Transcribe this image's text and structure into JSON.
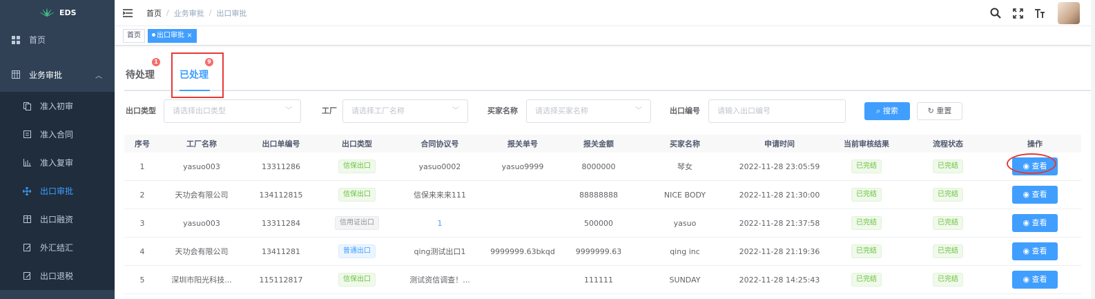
{
  "app": {
    "logo_text": "EDS"
  },
  "sidebar": {
    "items": [
      {
        "label": "首页",
        "icon": "dashboard-icon"
      },
      {
        "label": "业务审批",
        "icon": "table-icon",
        "expanded": true
      }
    ],
    "subitems": [
      {
        "label": "准入初审",
        "icon": "copy-icon"
      },
      {
        "label": "准入合同",
        "icon": "form-icon"
      },
      {
        "label": "准入复审",
        "icon": "chart-icon"
      },
      {
        "label": "出口审批",
        "icon": "move-icon",
        "active": true
      },
      {
        "label": "出口融资",
        "icon": "table2-icon"
      },
      {
        "label": "外汇结汇",
        "icon": "edit-icon"
      },
      {
        "label": "出口退税",
        "icon": "edit2-icon"
      }
    ]
  },
  "breadcrumb": {
    "home": "首页",
    "mid": "业务审批",
    "current": "出口审批",
    "sep": "/"
  },
  "tags_view": {
    "tags": [
      "首页",
      "出口审批"
    ],
    "close": "×"
  },
  "tabs": [
    {
      "label": "待处理",
      "badge": "1"
    },
    {
      "label": "已处理",
      "badge": "9"
    }
  ],
  "filters": {
    "export_type": {
      "label": "出口类型",
      "placeholder": "请选择出口类型"
    },
    "factory": {
      "label": "工厂",
      "placeholder": "请选择工厂名称"
    },
    "buyer": {
      "label": "买家名称",
      "placeholder": "请选择买家名称"
    },
    "export_no": {
      "label": "出口编号",
      "placeholder": "请输入出口编号"
    },
    "search_label": "搜索",
    "reset_label": "重置"
  },
  "table": {
    "headers": [
      "序号",
      "工厂名称",
      "出口单编号",
      "出口类型",
      "合同协议号",
      "报关单号",
      "报关金额",
      "买家名称",
      "申请时间",
      "当前审核结果",
      "流程状态",
      "操作"
    ],
    "rows": [
      [
        "1",
        "yasuo003",
        "13311286",
        "信保出口",
        "yasuo0002",
        "yasuo9999",
        "8000000",
        "琴女",
        "2022-11-28 23:05:59",
        "已完结",
        "已完结",
        "查看"
      ],
      [
        "2",
        "天功会有限公司",
        "134112815",
        "信保出口",
        "信保来来来111",
        "",
        "88888888",
        "NICE BODY",
        "2022-11-28 21:30:00",
        "已完结",
        "已完结",
        "查看"
      ],
      [
        "3",
        "yasuo003",
        "13311284",
        "信用证出口",
        "1",
        "",
        "500000",
        "yasuo",
        "2022-11-28 21:37:58",
        "已完结",
        "已完结",
        "查看"
      ],
      [
        "4",
        "天功会有限公司",
        "13411281",
        "普通出口",
        "qing测试出口1",
        "9999999.63bkqd",
        "9999999.63",
        "qing inc",
        "2022-11-28 21:19:36",
        "已完结",
        "已完结",
        "查看"
      ],
      [
        "5",
        "深圳市阳光科技...",
        "115112817",
        "信保出口",
        "测试资信调查！...",
        "",
        "111111",
        "SUNDAY",
        "2022-11-28 14:25:43",
        "已完结",
        "已完结",
        "查看"
      ]
    ]
  },
  "colors": {
    "primary": "#409eff",
    "sidebar_bg": "#304156",
    "submenu_bg": "#1f2d3d",
    "badge": "#f56c6c",
    "annotation": "#e53935",
    "success": "#67c23a"
  }
}
